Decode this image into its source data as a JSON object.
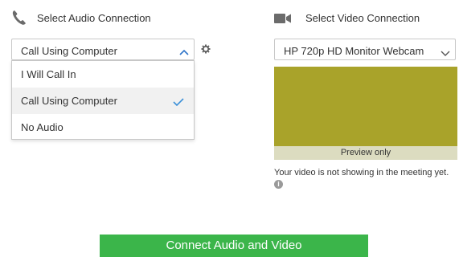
{
  "audio": {
    "title": "Select Audio Connection",
    "icon": "phone-icon",
    "selected": "Call Using Computer",
    "options": [
      {
        "label": "I Will Call In",
        "selected": false
      },
      {
        "label": "Call Using Computer",
        "selected": true
      },
      {
        "label": "No Audio",
        "selected": false
      }
    ]
  },
  "video": {
    "title": "Select Video Connection",
    "icon": "video-camera-icon",
    "selected": "HP 720p HD Monitor Webcam",
    "preview_label": "Preview only",
    "message": "Your video is not showing in the meeting yet."
  },
  "actions": {
    "connect_label": "Connect Audio and Video"
  },
  "colors": {
    "accent_check": "#3a8fd8",
    "connect_button": "#3bb54a",
    "preview": "#a9a32a"
  }
}
